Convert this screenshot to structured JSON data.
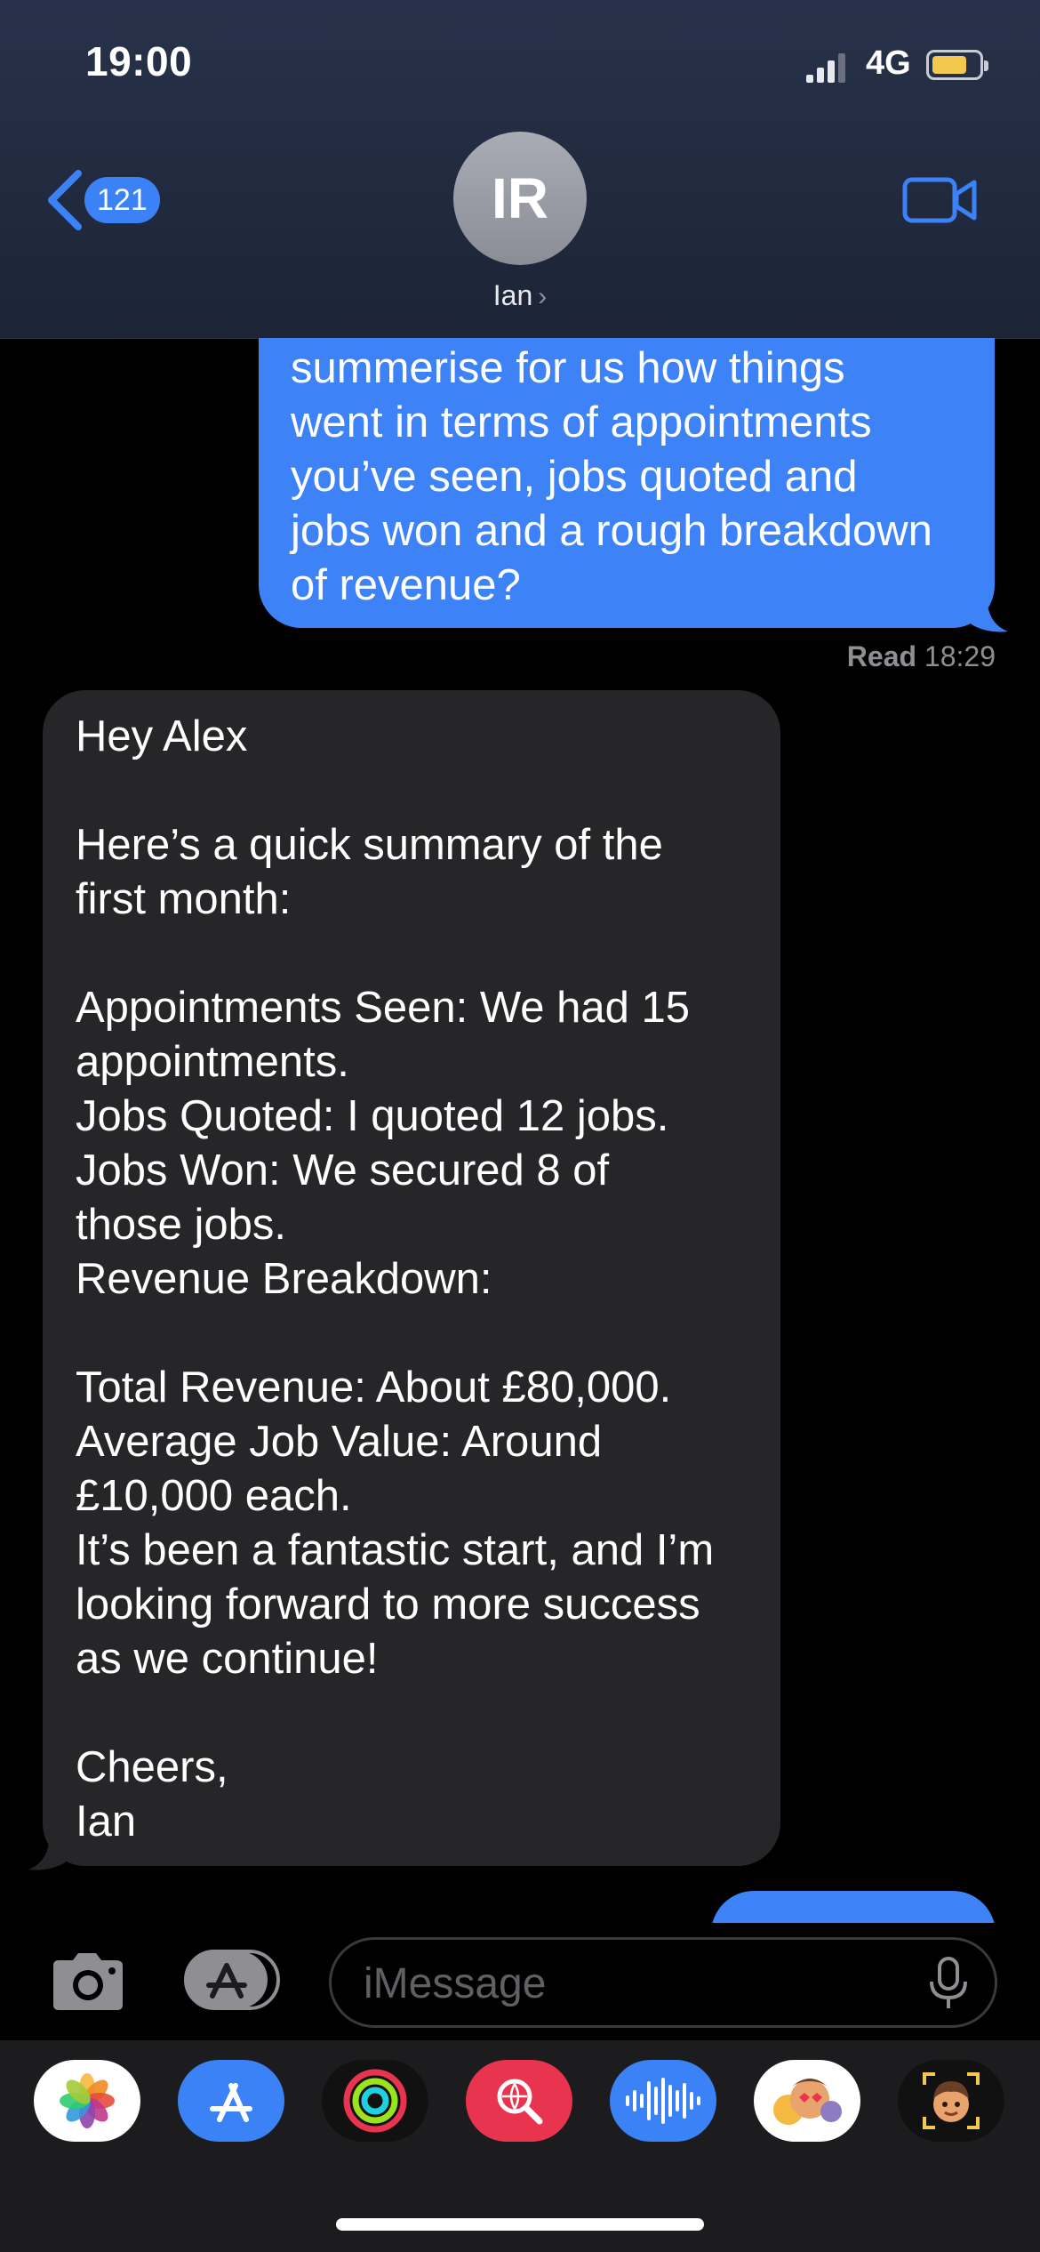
{
  "status_bar": {
    "time": "19:00",
    "network": "4G"
  },
  "nav": {
    "unread_count": "121",
    "avatar_initials": "IR",
    "contact_name": "Ian"
  },
  "messages": {
    "outgoing_lines": [
      "summerise for us how things",
      "went in terms of appointments",
      "you’ve seen, jobs quoted and",
      "jobs won and a rough breakdown",
      "of revenue?"
    ],
    "receipt_label": "Read",
    "receipt_time": "18:29",
    "incoming_lines": [
      "Hey Alex",
      "",
      "Here’s a quick summary of the",
      "first month:",
      "",
      "Appointments Seen: We had 15",
      "appointments.",
      "Jobs Quoted: I quoted 12 jobs.",
      "Jobs Won: We secured 8 of",
      "those jobs.",
      "Revenue Breakdown:",
      "",
      "Total Revenue: About £80,000.",
      "Average Job Value: Around",
      "£10,000 each.",
      "It’s been a fantastic start, and I’m",
      "looking forward to more success",
      "as we continue!",
      "",
      "Cheers,",
      "Ian"
    ]
  },
  "compose": {
    "placeholder": "iMessage"
  },
  "app_drawer": [
    "photos-icon",
    "app-store-icon",
    "activity-icon",
    "web-images-icon",
    "audio-message-icon",
    "memoji-stickers-icon",
    "memoji-icon"
  ]
}
